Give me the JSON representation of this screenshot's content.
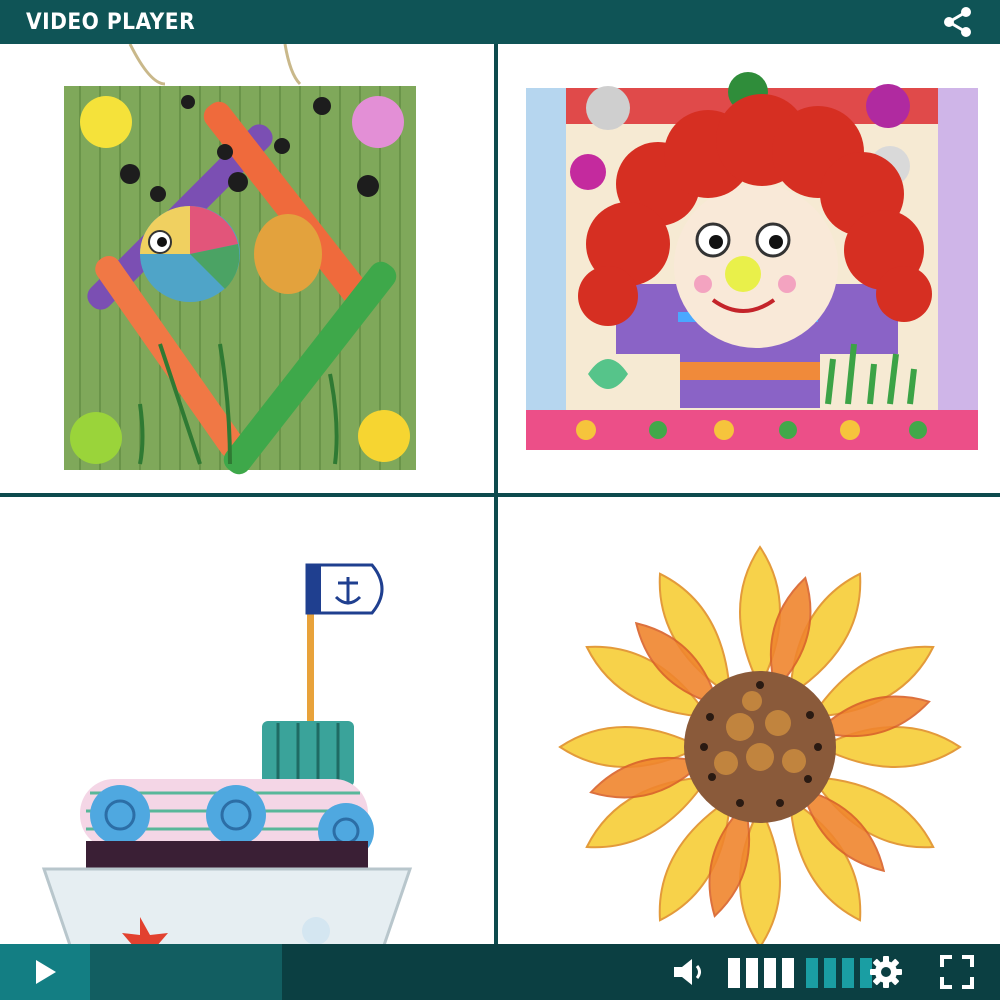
{
  "player": {
    "title": "VIDEO PLAYER",
    "progress": 0.0,
    "volume_level": 0.5,
    "volume_bar_count": 8
  },
  "colors": {
    "titlebar": "#0f5456",
    "play_accent": "#137e83",
    "volume_on": "#ffffff",
    "volume_off": "#1a9ea3"
  },
  "icons": [
    "share-icon",
    "play-icon",
    "volume-icon",
    "gear-icon",
    "fullscreen-icon"
  ]
}
